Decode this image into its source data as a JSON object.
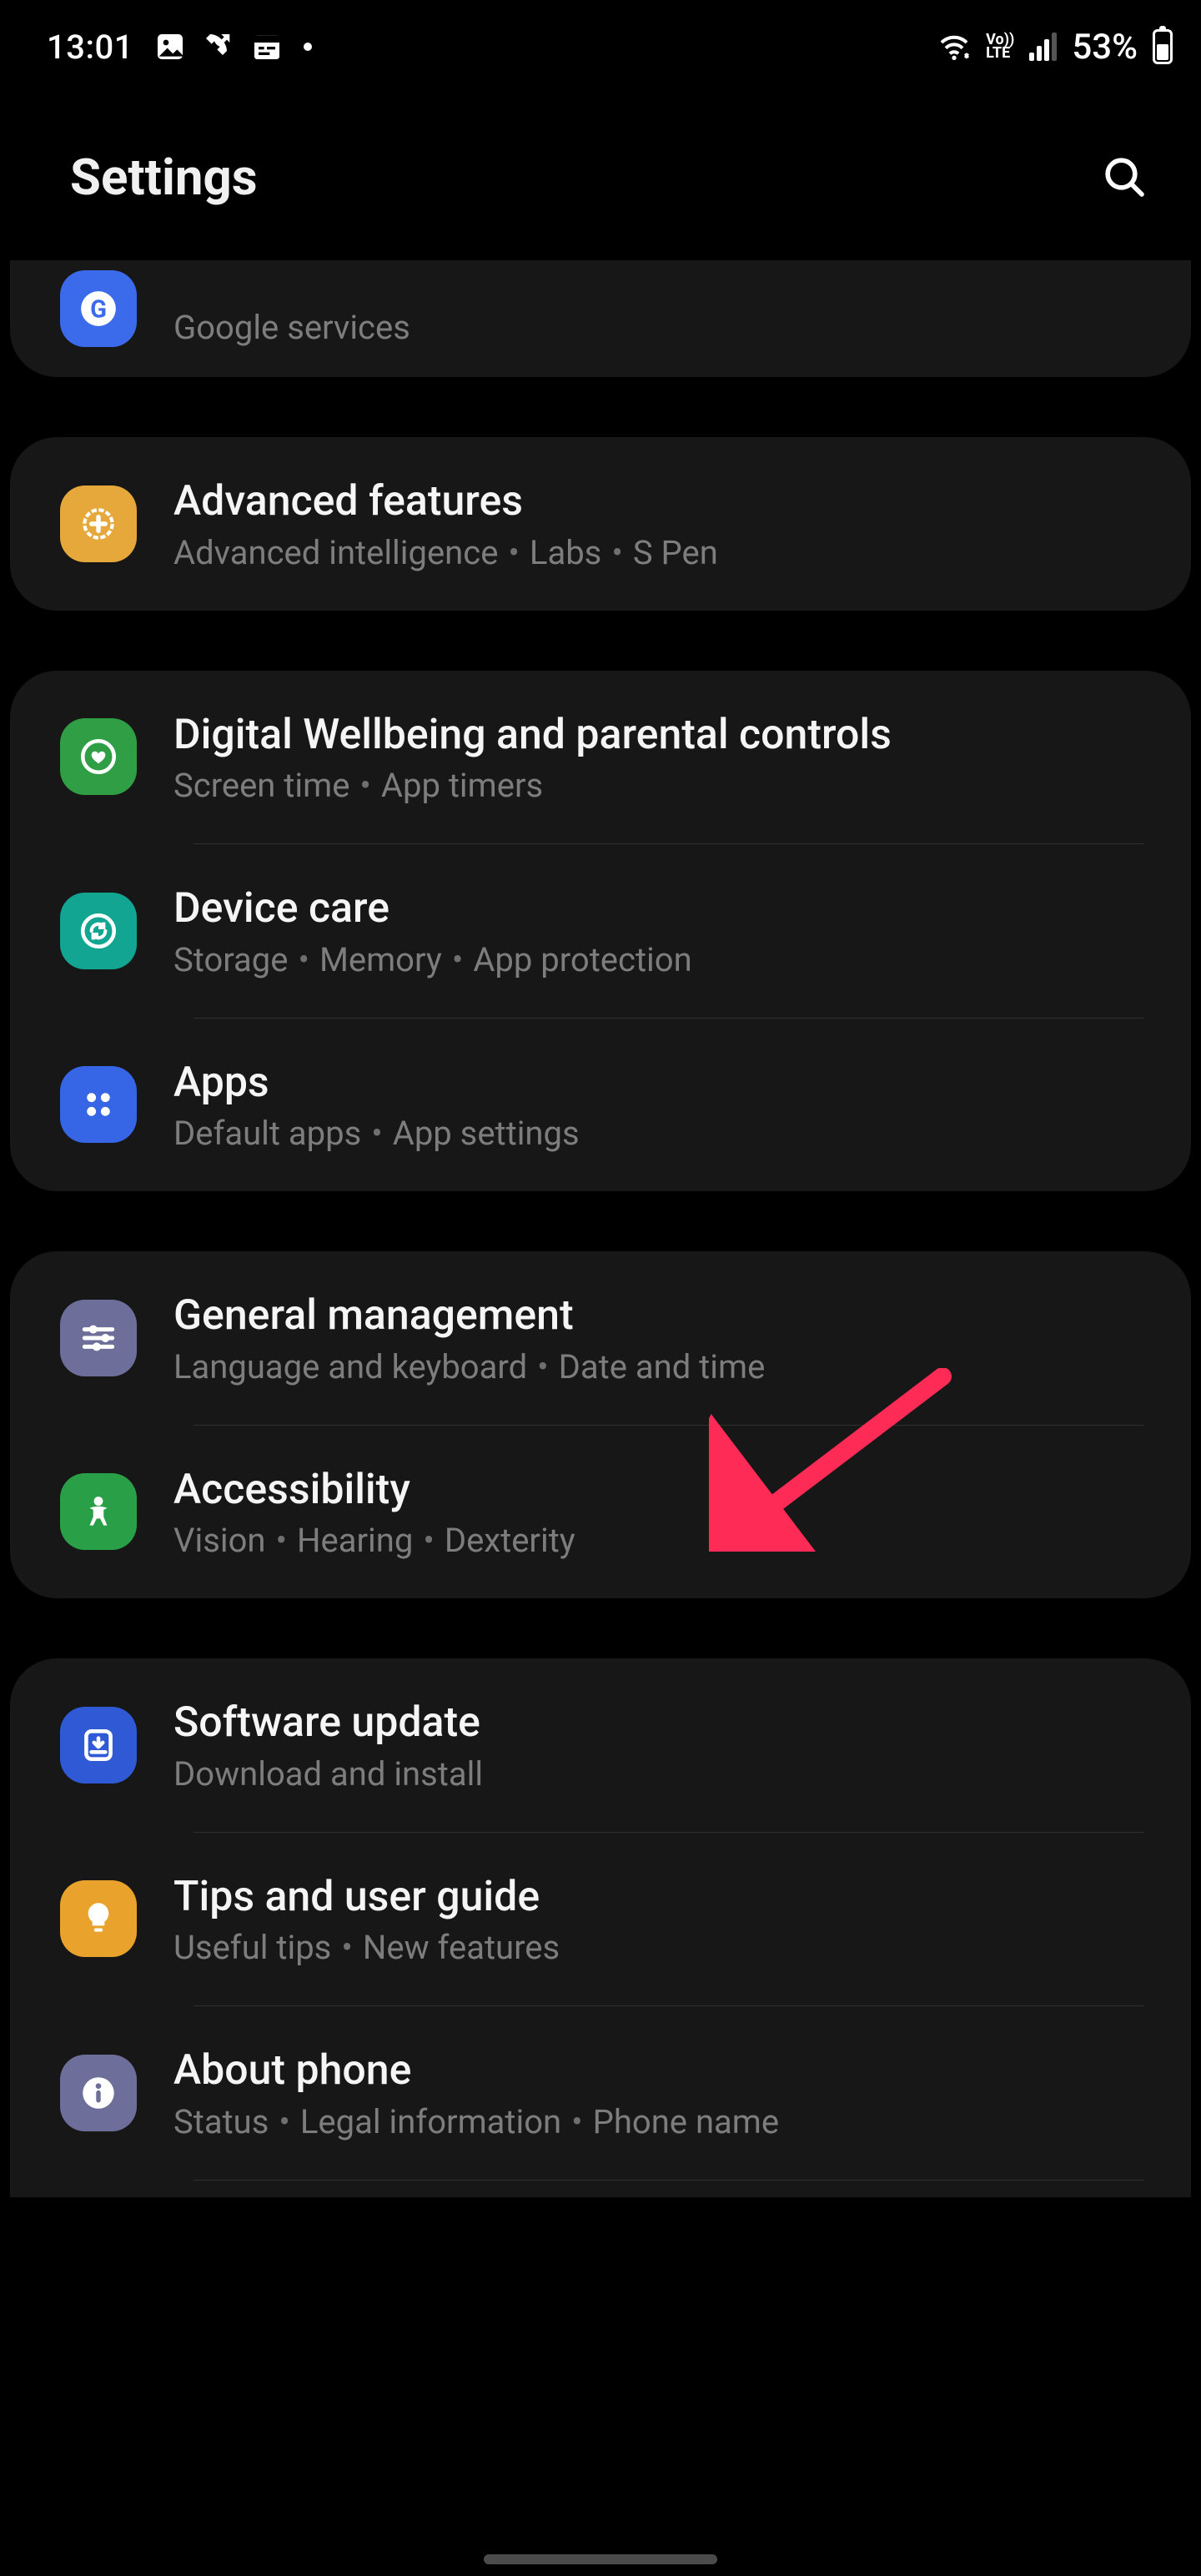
{
  "status": {
    "time": "13:01",
    "battery_pct": "53%",
    "network_label": "Vo))\nLTE"
  },
  "header": {
    "title": "Settings"
  },
  "groups": [
    {
      "partial_top": true,
      "items": [
        {
          "id": "google",
          "icon": "google-icon",
          "icon_bg": "bg-blue",
          "title": "Google",
          "subtitle_parts": [
            "Google services"
          ]
        }
      ]
    },
    {
      "items": [
        {
          "id": "advanced-features",
          "icon": "plus-gear-icon",
          "icon_bg": "bg-amber",
          "title": "Advanced features",
          "subtitle_parts": [
            "Advanced intelligence",
            "Labs",
            "S Pen"
          ]
        }
      ]
    },
    {
      "items": [
        {
          "id": "digital-wellbeing",
          "icon": "heart-circle-icon",
          "icon_bg": "bg-green",
          "title": "Digital Wellbeing and parental controls",
          "subtitle_parts": [
            "Screen time",
            "App timers"
          ]
        },
        {
          "id": "device-care",
          "icon": "refresh-circle-icon",
          "icon_bg": "bg-teal",
          "title": "Device care",
          "subtitle_parts": [
            "Storage",
            "Memory",
            "App protection"
          ]
        },
        {
          "id": "apps",
          "icon": "apps-grid-icon",
          "icon_bg": "bg-blue2",
          "title": "Apps",
          "subtitle_parts": [
            "Default apps",
            "App settings"
          ]
        }
      ]
    },
    {
      "items": [
        {
          "id": "general-management",
          "icon": "sliders-icon",
          "icon_bg": "bg-slate",
          "title": "General management",
          "subtitle_parts": [
            "Language and keyboard",
            "Date and time"
          ]
        },
        {
          "id": "accessibility",
          "icon": "person-icon",
          "icon_bg": "bg-green2",
          "title": "Accessibility",
          "subtitle_parts": [
            "Vision",
            "Hearing",
            "Dexterity"
          ]
        }
      ]
    },
    {
      "items": [
        {
          "id": "software-update",
          "icon": "download-circle-icon",
          "icon_bg": "bg-blue3",
          "title": "Software update",
          "subtitle_parts": [
            "Download and install"
          ]
        },
        {
          "id": "tips",
          "icon": "lightbulb-icon",
          "icon_bg": "bg-amber2",
          "title": "Tips and user guide",
          "subtitle_parts": [
            "Useful tips",
            "New features"
          ]
        },
        {
          "id": "about-phone",
          "icon": "info-icon",
          "icon_bg": "bg-slate2",
          "title": "About phone",
          "subtitle_parts": [
            "Status",
            "Legal information",
            "Phone name"
          ]
        }
      ]
    }
  ],
  "annotation": {
    "target": "general-management",
    "color": "#ff2b57"
  }
}
